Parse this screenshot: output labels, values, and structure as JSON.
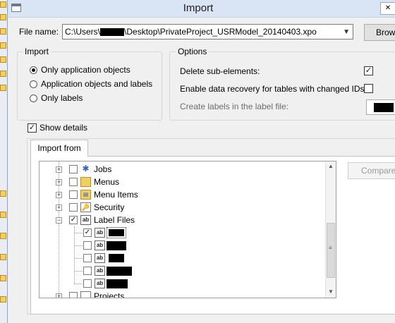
{
  "window": {
    "title": "Import"
  },
  "file": {
    "label": "File name:",
    "path_prefix": "C:\\Users\\",
    "path_suffix": "\\Desktop\\PrivateProject_USRModel_20140403.xpo",
    "browse_label": "Brow"
  },
  "import_group": {
    "title": "Import",
    "options": [
      {
        "label": "Only application objects",
        "selected": true
      },
      {
        "label": "Application objects and labels",
        "selected": false
      },
      {
        "label": "Only labels",
        "selected": false
      }
    ]
  },
  "options_group": {
    "title": "Options",
    "delete_sub_elements": {
      "label": "Delete sub-elements:",
      "checked": true
    },
    "data_recovery": {
      "label": "Enable data recovery for tables with changed IDs:",
      "checked": false
    },
    "create_labels": {
      "label": "Create labels in the label file:"
    }
  },
  "show_details": {
    "label": "Show details",
    "checked": true
  },
  "tab": {
    "label": "Import from"
  },
  "tree": {
    "nodes": [
      {
        "label": "Jobs",
        "icon": "jobs-icon"
      },
      {
        "label": "Menus",
        "icon": "menus-folder-icon"
      },
      {
        "label": "Menu Items",
        "icon": "menu-items-icon"
      },
      {
        "label": "Security",
        "icon": "security-icon"
      },
      {
        "label": "Label Files",
        "icon": "label-files-icon",
        "checked": true,
        "expanded": true
      },
      {
        "label": "Projects",
        "icon": "projects-icon"
      }
    ],
    "label_children": [
      {
        "icon_text": "ab",
        "checked": true,
        "selected": true
      },
      {
        "icon_text": "ab",
        "checked": false
      },
      {
        "icon_text": "ab",
        "checked": false
      },
      {
        "icon_text": "ab",
        "checked": false
      },
      {
        "icon_text": "ab",
        "checked": false
      }
    ]
  },
  "compare": {
    "label": "Compare"
  }
}
